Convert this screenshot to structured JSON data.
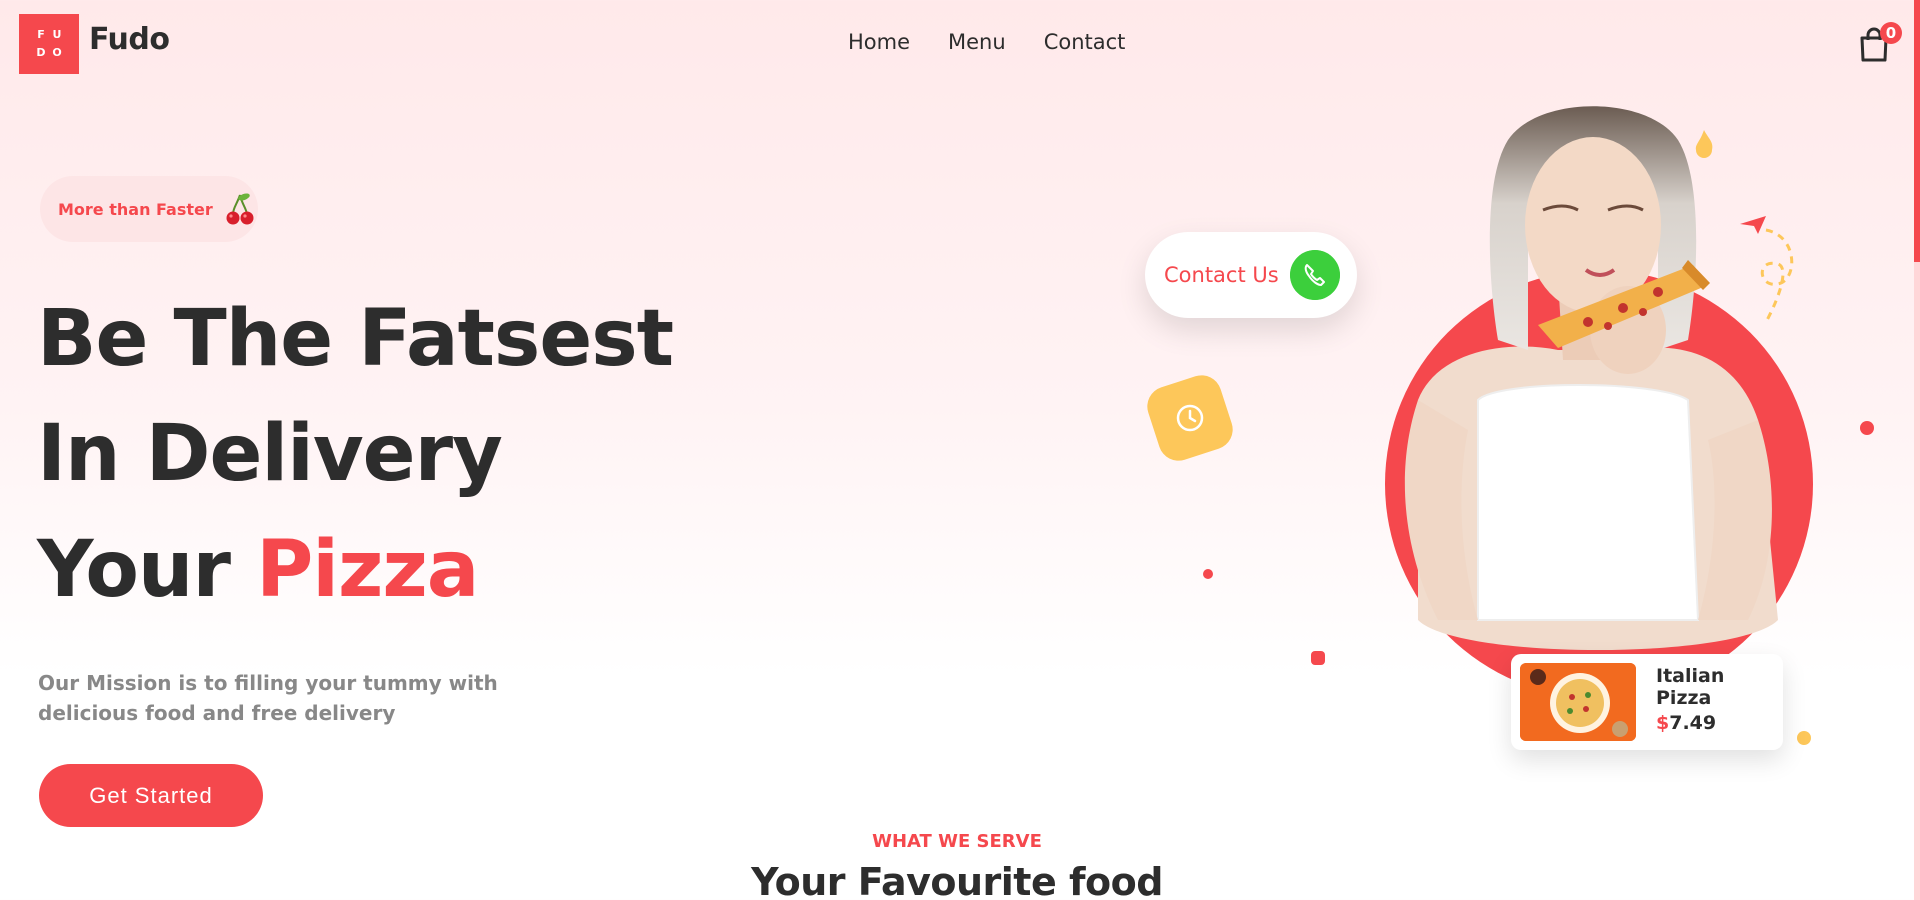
{
  "header": {
    "logo_letters": [
      "F",
      "U",
      "D",
      "O"
    ],
    "brand": "Fudo",
    "nav": [
      {
        "label": "Home"
      },
      {
        "label": "Menu"
      },
      {
        "label": "Contact"
      }
    ],
    "cart_count": "0"
  },
  "hero": {
    "tagline": "More than Faster",
    "tagline_icon": "cherries-icon",
    "headline_line1": "Be The Fatsest",
    "headline_line2": "In Delivery",
    "headline_line3_prefix": "Your",
    "headline_line3_accent": "Pizza",
    "mission": "Our Mission is to filling your tummy with delicious food and free delivery",
    "cta_label": "Get Started"
  },
  "contact_bubble": {
    "label": "Contact Us",
    "icon": "phone-icon"
  },
  "product_card": {
    "title": "Italian Pizza",
    "currency": "$",
    "price": "7.49"
  },
  "section": {
    "eyebrow": "WHAT WE SERVE",
    "title": "Your Favourite food"
  },
  "colors": {
    "accent": "#f5484d",
    "yellow": "#fdc75a",
    "green": "#3ccf3c",
    "text": "#2d2d2d",
    "muted": "#888888"
  }
}
